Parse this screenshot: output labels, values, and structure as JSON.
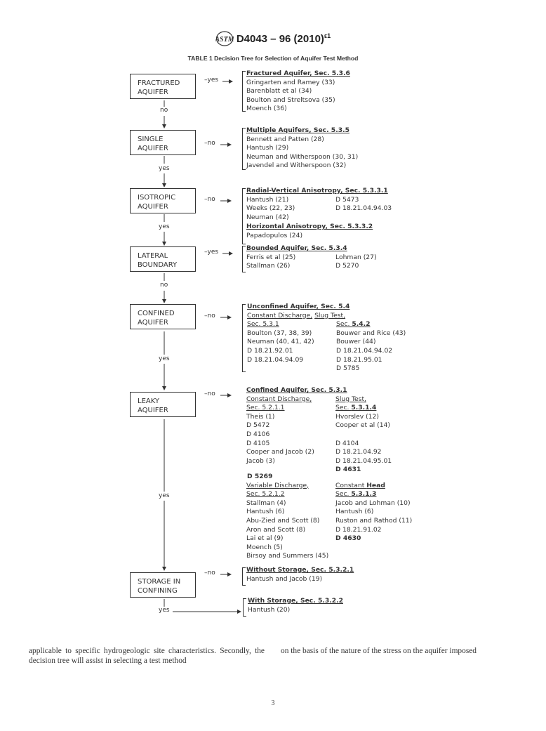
{
  "header": {
    "logo": "astm-logo-icon",
    "designation": "D4043 – 96 (2010)",
    "superscript": "ε1"
  },
  "table_title": "TABLE 1 Decision Tree for Selection of Aquifer Test Method",
  "nodes": [
    {
      "line1": "FRACTURED",
      "line2": "AQUIFER",
      "branch_label": "–yes",
      "down_label": "no"
    },
    {
      "line1": "SINGLE",
      "line2": "AQUIFER",
      "branch_label": "–no",
      "down_label": "yes"
    },
    {
      "line1": "ISOTROPIC",
      "line2": "AQUIFER",
      "branch_label": "–no",
      "down_label": "yes"
    },
    {
      "line1": "LATERAL",
      "line2": "BOUNDARY",
      "branch_label": "–yes",
      "down_label": "no"
    },
    {
      "line1": "CONFINED",
      "line2": "AQUIFER",
      "branch_label": "–no",
      "down_label": "yes"
    },
    {
      "line1": "LEAKY",
      "line2": "AQUIFER",
      "branch_label": "–no",
      "down_label": "yes"
    },
    {
      "line1": "STORAGE IN",
      "line2": "CONFINING",
      "branch_label": "–no",
      "down_label": "yes"
    }
  ],
  "results": {
    "fractured": {
      "heading": "Fractured Aquifer, Sec. 5.3.6",
      "items": [
        "Gringarten and Ramey (33)",
        "Barenblatt et al (34)",
        "Boulton and Streltsova (35)",
        "Moench (36)"
      ]
    },
    "multiple": {
      "heading": "Multiple Aquifers, Sec. 5.3.5",
      "items": [
        "Bennett and Patten (28)",
        "Hantush (29)",
        "Neuman and Witherspoon (30, 31)",
        "Javendel and Witherspoon (32)"
      ]
    },
    "radial": {
      "heading": "Radial-Vertical Anisotropy, Sec. 5.3.3.1",
      "left": [
        "Hantush (21)",
        "Weeks (22, 23)",
        "Neuman (42)"
      ],
      "right": [
        "D 5473",
        "D 18.21.04.94.03"
      ],
      "heading2": "Horizontal Anisotropy, Sec. 5.3.3.2",
      "items2": [
        "Papadopulos (24)"
      ]
    },
    "bounded": {
      "heading": "Bounded Aquifer, Sec. 5.3.4",
      "left": [
        "Ferris et al (25)",
        "Stallman (26)"
      ],
      "right": [
        "Lohman (27)",
        "D 5270"
      ]
    },
    "unconfined": {
      "heading": "Unconfined Aquifer, Sec. 5.4",
      "sub_left_a": "Constant Discharge,",
      "sub_right_a": "Slug Test,",
      "sub_left_b": "Sec. 5.3.1",
      "sub_right_b_prefix": "Sec. ",
      "sub_right_b_bold": "5.4.2",
      "left": [
        "Boulton (37, 38, 39)",
        "Neuman (40, 41, 42)",
        "D 18.21.92.01",
        "D 18.21.04.94.09"
      ],
      "right": [
        "Bouwer and Rice (43)",
        "Bouwer (44)",
        "D 18.21.04.94.02",
        "D 18.21.95.01",
        "D 5785"
      ]
    },
    "confined": {
      "heading": "Confined Aquifer, Sec. 5.3.1",
      "sub_left_a": "Constant Discharge,",
      "sub_left_b": "Sec. 5.2.1.1",
      "sub_right_a": "Slug Test,",
      "sub_right_b_prefix": "Sec. ",
      "sub_right_b_bold": "5.3.1.4",
      "left": [
        "Theis (1)",
        "D 5472",
        "D 4106",
        "D 4105",
        "Cooper and Jacob (2)",
        "Jacob (3)"
      ],
      "right": [
        "Hvorslev (12)",
        "Cooper et al (14)",
        "",
        "D 4104",
        "D 18.21.04.92",
        "D 18.21.04.95.01"
      ],
      "right_bold": "D 4631",
      "left_bold": "D 5269",
      "sub2_left_a": "Variable Discharge,",
      "sub2_left_b": "Sec. 5.2.1.2",
      "sub2_right_a_prefix": "Constant ",
      "sub2_right_a_bold": "Head",
      "sub2_right_b_prefix": "Sec. ",
      "sub2_right_b_bold": "5.3.1.3",
      "left2": [
        "Stallman (4)",
        "Hantush (6)",
        "Abu-Zied and Scott (8)",
        "Aron and Scott (8)",
        "Lai et al (9)",
        "Moench (5)",
        "Birsoy and Summers (45)"
      ],
      "right2": [
        "Jacob and Lohman (10)",
        "Hantush (6)",
        "Ruston and Rathod (11)",
        "D 18.21.91.02"
      ],
      "right2_bold": "D 4630"
    },
    "without_storage": {
      "heading": "Without Storage, Sec. 5.3.2.1",
      "items": [
        "Hantush and Jacob (19)"
      ]
    },
    "with_storage": {
      "heading": "With Storage, Sec. 5.3.2.2",
      "items": [
        "Hantush (20)"
      ]
    }
  },
  "body_text": {
    "col1": "applicable to specific hydrogeologic site characteristics. Secondly, the decision tree will assist in selecting a test method",
    "col2": "on the basis of the nature of the stress on the aquifer imposed"
  },
  "page_number": "3"
}
